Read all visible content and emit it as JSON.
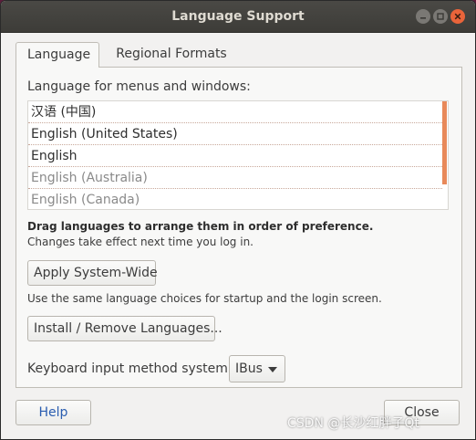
{
  "window": {
    "title": "Language Support"
  },
  "tabs": [
    {
      "label": "Language",
      "active": true
    },
    {
      "label": "Regional Formats",
      "active": false
    }
  ],
  "language": {
    "menus_label": "Language for menus and windows:",
    "languages": [
      {
        "label": "汉语 (中国)",
        "dim": false
      },
      {
        "label": "English (United States)",
        "dim": false
      },
      {
        "label": "English",
        "dim": false
      },
      {
        "label": "English (Australia)",
        "dim": true
      },
      {
        "label": "English (Canada)",
        "dim": true
      }
    ],
    "drag_hint": "Drag languages to arrange them in order of preference.",
    "changes_note": "Changes take effect next time you log in.",
    "apply_button": "Apply System-Wide",
    "apply_note": "Use the same language choices for startup and the login screen.",
    "install_button": "Install / Remove Languages...",
    "keyboard_label": "Keyboard input method system:",
    "keyboard_value": "IBus"
  },
  "footer": {
    "help_button": "Help",
    "close_button": "Close"
  },
  "watermark": "CSDN @长沙红胖子Qt",
  "colors": {
    "accent": "#e8895a",
    "titlebar": "#3d3c38",
    "close_button": "#e9643a",
    "help_text": "#2a5db0"
  }
}
